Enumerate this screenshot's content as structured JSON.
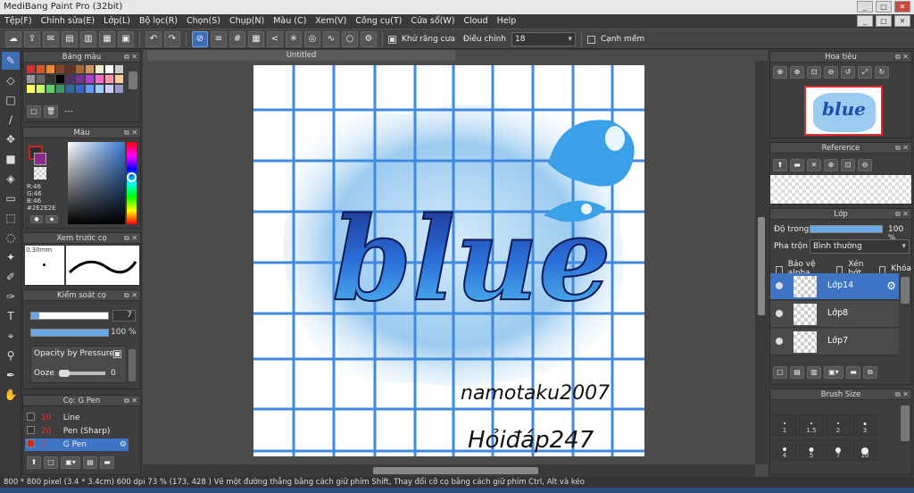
{
  "app": {
    "title": "MediBang Paint Pro (32bit)"
  },
  "window_buttons": [
    "_",
    "□",
    "✕"
  ],
  "menu": [
    "Tệp(F)",
    "Chỉnh sửa(E)",
    "Lớp(L)",
    "Bộ lọc(R)",
    "Chọn(S)",
    "Chụp(N)",
    "Màu (C)",
    "Xem(V)",
    "Công cụ(T)",
    "Cửa sổ(W)",
    "Cloud",
    "Help"
  ],
  "toolbar": {
    "antialias_label": "Khử răng cưa",
    "correction_label": "Điều chỉnh",
    "correction_value": "18",
    "snap_label": "Cạnh mềm"
  },
  "canvas": {
    "tab_title": "Untitled",
    "text_line1": "namotaku2007",
    "text_line2": "Hỏiđáp247",
    "word": "blue"
  },
  "palette_panel": {
    "title": "Bảng màu",
    "swatches": [
      "#cc3333",
      "#dd5522",
      "#ee8833",
      "#884422",
      "#663322",
      "#aa6633",
      "#cc9966",
      "#eeeecc",
      "#ffffff",
      "#cccccc",
      "#999999",
      "#666666",
      "#333333",
      "#000000",
      "#553366",
      "#773399",
      "#aa44cc",
      "#ff66cc",
      "#ff99aa",
      "#ffcc99",
      "#ffff66",
      "#ccff66",
      "#66cc66",
      "#339966",
      "#336699",
      "#3366cc",
      "#6699ff",
      "#99ccff",
      "#ccccff",
      "#9999cc"
    ],
    "field": "---"
  },
  "color_panel": {
    "title": "Màu",
    "r": "R:46",
    "g": "G:46",
    "b": "B:46",
    "hex": "#2E2E2E"
  },
  "preview_panel": {
    "title": "Xem trước cọ",
    "size": "0.30mm"
  },
  "brush_control": {
    "title": "Kiểm soát cọ",
    "size_value": "7",
    "opacity_value": "100 %",
    "pressure_label": "Opacity by Pressure",
    "ooze_label": "Ooze",
    "ooze_value": "0"
  },
  "brush_list": {
    "title": "Cọ: G Pen",
    "items": [
      {
        "size": "10",
        "name": "Line",
        "color": "#333333"
      },
      {
        "size": "20",
        "name": "Pen (Sharp)",
        "color": "#333333"
      },
      {
        "size": "7",
        "name": "G Pen",
        "color": "#dd2222"
      }
    ]
  },
  "navigator": {
    "title": "Hoa tiêu"
  },
  "reference": {
    "title": "Reference"
  },
  "layers": {
    "title": "Lớp",
    "opacity_label": "Độ trong",
    "opacity_value": "100 %",
    "blend_label": "Pha trộn",
    "blend_value": "Bình thường",
    "protect_alpha": "Bảo vệ alpha",
    "clipping": "Xén bớt",
    "lock": "Khóa",
    "items": [
      "Lớp14",
      "Lớp8",
      "Lớp7"
    ]
  },
  "brush_size": {
    "title": "Brush Size",
    "sizes": [
      "1",
      "1.5",
      "2",
      "3",
      "4",
      "5",
      "7",
      "10"
    ]
  },
  "status": {
    "text": "800 * 800 pixel   (3.4 * 3.4cm)   600 dpi   73 %   (173, 428 )   Vẽ một đường thẳng bằng cách giữ phím Shift, Thay đổi cỡ cọ bằng cách giữ phím Ctrl, Alt và kéo"
  }
}
